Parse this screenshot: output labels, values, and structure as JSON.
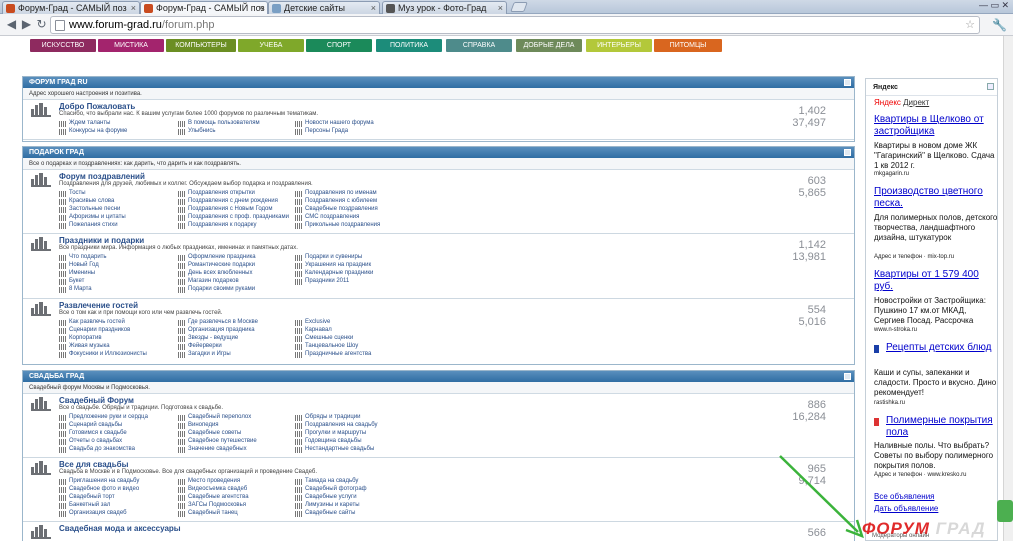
{
  "browser": {
    "tabs": [
      {
        "title": "Форум-Град - САМЫЙ поз",
        "active": false
      },
      {
        "title": "Форум-Град - САМЫЙ поз",
        "active": true
      },
      {
        "title": "Детские сайты",
        "active": false
      },
      {
        "title": "Муз урок - Фото-Град",
        "active": false
      }
    ],
    "url_host": "www.forum-grad.ru",
    "url_path": "/forum.php"
  },
  "menu": [
    {
      "label": "ИСКУССТВО",
      "color": "#8e2a5f"
    },
    {
      "label": "МИСТИКА",
      "color": "#a3246d"
    },
    {
      "label": "КОМПЬЮТЕРЫ",
      "color": "#6b8e23"
    },
    {
      "label": "УЧЕБА",
      "color": "#7fa82a"
    },
    {
      "label": "СПОРТ",
      "color": "#1b8a5a"
    },
    {
      "label": "ПОЛИТИКА",
      "color": "#1c8c7a"
    },
    {
      "label": "СПРАВКА",
      "color": "#4e8b8b"
    },
    {
      "label": "ДОБРЫЕ ДЕЛА",
      "color": "#6e8a5a"
    },
    {
      "label": "ИНТЕРЬЕРЫ",
      "color": "#b3c83a"
    },
    {
      "label": "ПИТОМЦЫ",
      "color": "#d9661f"
    }
  ],
  "sections": [
    {
      "title": "ФОРУМ ГРАД RU",
      "desc": "Адрес хорошего настроения и позитива.",
      "forums": [
        {
          "title": "Добро Пожаловать",
          "desc": "Спасибо, что выбрали нас. К вашим услугам более 1000 форумов по различным тематикам.",
          "subs": [
            "Ждем таланты",
            "В помощь пользователям",
            "Новости нашего форума",
            "Конкурсы на форуме",
            "Улыбнись",
            "Персоны Града"
          ],
          "threads": "1,402",
          "posts": "37,497"
        }
      ]
    },
    {
      "title": "ПОДАРОК ГРАД",
      "desc": "Все о подарках и поздравлениях: как дарить, что дарить и как поздравлять.",
      "forums": [
        {
          "title": "Форум поздравлений",
          "desc": "Поздравления для друзей, любимых и коллег. Обсуждаем выбор подарка и поздравления.",
          "subs": [
            "Тосты",
            "Поздравления открытки",
            "Поздравления по именам",
            "Красивые слова",
            "Поздравления с днем рождения",
            "Поздравления с юбилеем",
            "Застольные песни",
            "Поздравления с Новым Годом",
            "Свадебные поздравления",
            "Афоризмы и цитаты",
            "Поздравления с проф. праздниками",
            "СМС поздравления",
            "Пожелания стихи",
            "Поздравления к подарку",
            "Прикольные поздравления"
          ],
          "threads": "603",
          "posts": "5,865"
        },
        {
          "title": "Праздники и подарки",
          "desc": "Все праздники мира. Информация о любых праздниках, именинах и памятных датах.",
          "subs": [
            "Что подарить",
            "Оформление праздника",
            "Подарки и сувениры",
            "Новый Год",
            "Романтические подарки",
            "Украшения на праздник",
            "Именины",
            "День всех влюбленных",
            "Календарные праздники",
            "Букет",
            "Магазин подарков",
            "Праздники 2011",
            "8 Марта",
            "Подарки своими руками"
          ],
          "threads": "1,142",
          "posts": "13,981"
        },
        {
          "title": "Развлечение гостей",
          "desc": "Все о том как и при помощи кого или чем развлечь гостей.",
          "subs": [
            "Как развлечь гостей",
            "Где развлечься в Москве",
            "Exclusive",
            "Сценарии праздников",
            "Организация праздника",
            "Карнавал",
            "Корпоратив",
            "Звезды - ведущие",
            "Смешные сценки",
            "Живая музыка",
            "Фейерверки",
            "Танцевальное Шоу",
            "Фокусники и Иллюзионисты",
            "Загадки и Игры",
            "Праздничные агентства"
          ],
          "threads": "554",
          "posts": "5,016"
        }
      ]
    },
    {
      "title": "СВАДЬБА ГРАД",
      "desc": "Свадебный форум Москвы и Подмосковья.",
      "forums": [
        {
          "title": "Свадебный Форум",
          "desc": "Все о свадьбе. Обряды и традиции. Подготовка к свадьбе.",
          "subs": [
            "Предложение руки и сердца",
            "Свадебный переполох",
            "Обряды и традиции",
            "Сценарий свадьбы",
            "Винопедия",
            "Поздравления на свадьбу",
            "Готовимся к свадьбе",
            "Свадебные советы",
            "Прогулки и маршруты",
            "Отчеты о свадьбах",
            "Свадебное путешествие",
            "Годовщина свадьбы",
            "Свадьба до знакомства",
            "Значение свадебных",
            "Нестандартные свадьбы"
          ],
          "threads": "886",
          "posts": "16,284"
        },
        {
          "title": "Все для свадьбы",
          "desc": "Свадьба в Москве и в Подмосковье. Все для свадебных организаций и проведение Свадеб.",
          "subs": [
            "Приглашения на свадьбу",
            "Место проведения",
            "Тамада на свадьбу",
            "Свадебное фото и видео",
            "Видеосъемка свадеб",
            "Свадебный фотограф",
            "Свадебный торт",
            "Свадебные агентства",
            "Свадебные услуги",
            "Банкетный зал",
            "ЗАГСы Подмосковья",
            "Лимузины и кареты",
            "Организация свадеб",
            "Свадебный танец",
            "Свадебные сайты"
          ],
          "threads": "965",
          "posts": "9,714"
        },
        {
          "title": "Свадебная мода и аксессуары",
          "desc": "",
          "subs": [],
          "threads": "566",
          "posts": ""
        }
      ]
    }
  ],
  "sidebar": {
    "title": "Яндекс",
    "yandex": "Яндекс",
    "direct": "Директ",
    "ads": [
      {
        "title": "Квартиры в Щелково от застройщика",
        "text": "Квартиры в новом доме ЖК \"Гагаринский\" в Щелково. Сдача 1 кв 2012 г.",
        "url": "mkgagarin.ru"
      },
      {
        "title": "Производство цветного песка.",
        "text": "Для полимерных полов, детского творчества, ландшафтного дизайна, штукатурок",
        "url": "Адрес и телефон · mix-top.ru"
      },
      {
        "title": "Квартиры от 1 579 400 руб.",
        "text": "Новостройки от Застройщика: Пушкино 17 км.от МКАД, Сергиев Посад. Рассрочка",
        "url": "www.n-stroka.ru"
      },
      {
        "title": "Рецепты детских блюд",
        "text": "Каши и супы, запеканки и сладости. Просто и вкусно. Дино рекомендует!",
        "url": "rastishka.ru"
      },
      {
        "title": "Полимерные покрытия пола",
        "text": "Наливные полы. Что выбрать? Советы по выбору полимерного покрытия полов.",
        "url": "Адрес и телефон · www.kresko.ru"
      }
    ],
    "all_ads": "Все объявления",
    "place_ad": "Дать объявление"
  },
  "watermark": {
    "brand": "ФОРУМ",
    "suffix": "ГРАД"
  },
  "footer_hint": "Модераторы онлайн"
}
